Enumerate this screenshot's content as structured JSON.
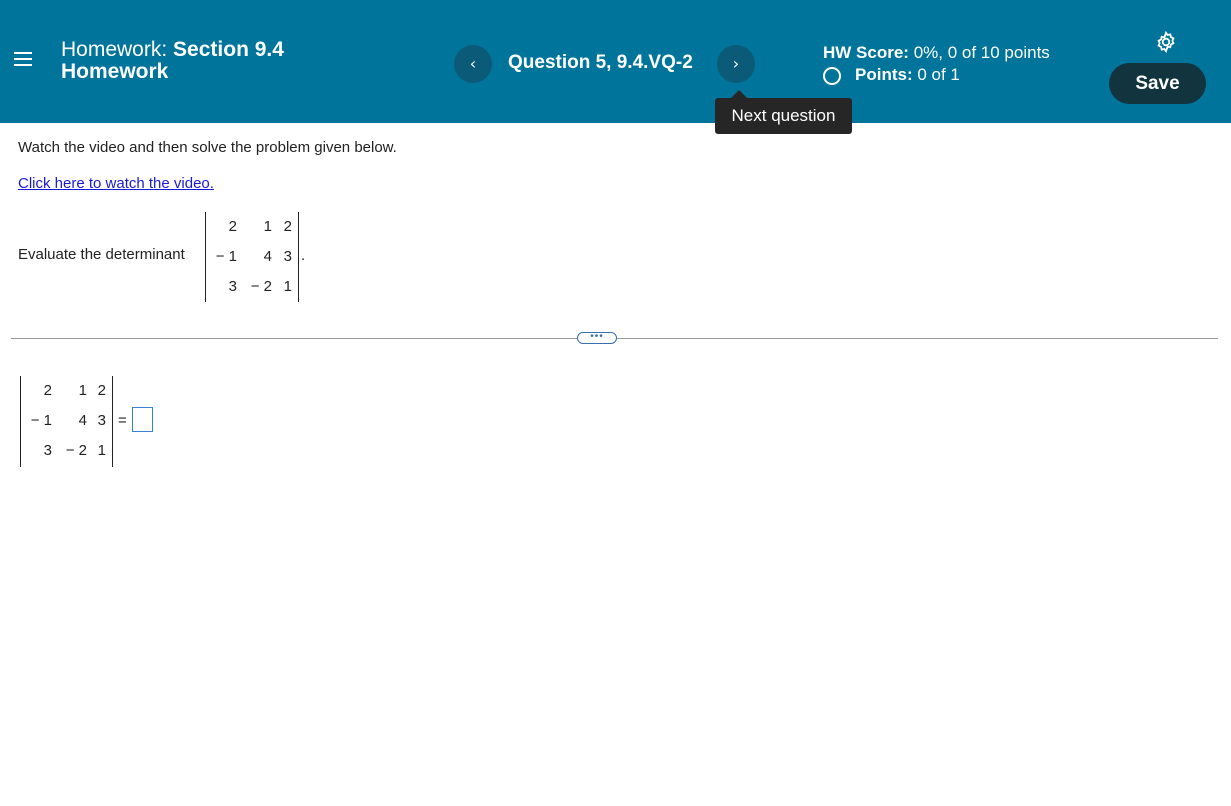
{
  "header": {
    "menu_icon": "hamburger-icon",
    "title_prefix": "Homework:",
    "title_section": "Section 9.4",
    "title_line2": "Homework",
    "prev_label": "‹",
    "next_label": "›",
    "question": "Question 5, 9.4.VQ-2",
    "hw_score_label": "HW Score:",
    "hw_score_value": "0%, 0 of 10 points",
    "points_label": "Points:",
    "points_value": "0 of 1",
    "settings_icon": "gear-icon",
    "save_label": "Save",
    "tooltip": "Next question",
    "colors": {
      "header_bg": "#00749a",
      "nav_btn": "#0b5a78",
      "save_btn": "#11343f"
    }
  },
  "content": {
    "instructions": "Watch the video and then solve the problem given below.",
    "video_link": "Click here to watch the video.",
    "evaluate_label": "Evaluate the determinant",
    "matrix": [
      [
        "2",
        "1",
        "2"
      ],
      [
        "− 1",
        "4",
        "3"
      ],
      [
        "3",
        "− 2",
        "1"
      ]
    ],
    "period": ".",
    "divider_handle": "•••",
    "equals": "=",
    "answer_value": ""
  }
}
